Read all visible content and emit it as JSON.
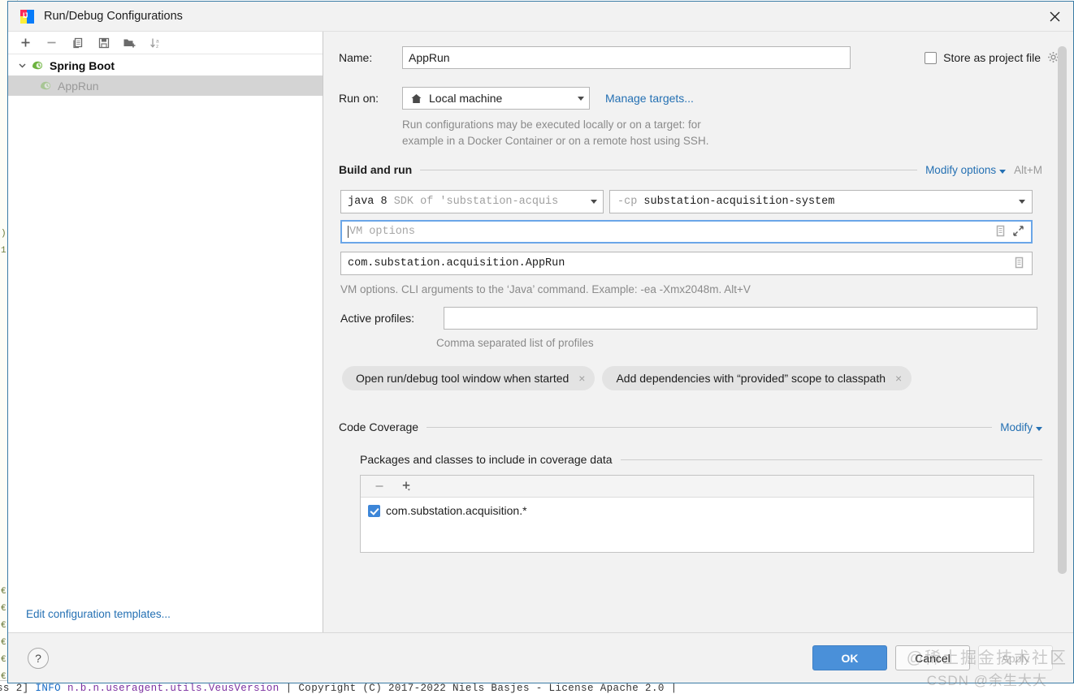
{
  "window": {
    "title": "Run/Debug Configurations",
    "app_icon": "intellij-idea-icon",
    "close_icon": "close-icon"
  },
  "tree_toolbar": {
    "items": [
      {
        "name": "add-configuration-button",
        "icon": "plus-icon"
      },
      {
        "name": "remove-configuration-button",
        "icon": "minus-icon"
      },
      {
        "name": "copy-configuration-button",
        "icon": "copy-icon"
      },
      {
        "name": "save-configuration-button",
        "icon": "save-icon"
      },
      {
        "name": "new-folder-button",
        "icon": "folder-add-icon"
      },
      {
        "name": "sort-configurations-button",
        "icon": "sort-alpha-icon"
      }
    ]
  },
  "tree": {
    "group_label": "Spring Boot",
    "child_label": "AppRun",
    "edit_templates_link": "Edit configuration templates..."
  },
  "form": {
    "name_label": "Name:",
    "name_value": "AppRun",
    "store_as_project_file_label": "Store as project file",
    "store_as_project_file_checked": false,
    "run_on_label": "Run on:",
    "run_on_value": "Local machine",
    "manage_targets_link": "Manage targets...",
    "run_on_hint_line1": "Run configurations may be executed locally or on a target: for",
    "run_on_hint_line2": "example in a Docker Container or on a remote host using SSH."
  },
  "build_and_run": {
    "section_title": "Build and run",
    "modify_options_link": "Modify options",
    "modify_options_shortcut": "Alt+M",
    "sdk_value_bold": "java 8",
    "sdk_value_dim": " SDK of 'substation-acquis",
    "classpath_prefix": "-cp ",
    "classpath_value": "substation-acquisition-system",
    "vm_options_placeholder": "VM options",
    "main_class_value": "com.substation.acquisition.AppRun",
    "vm_options_hint": "VM options. CLI arguments to the ‘Java’ command. Example: -ea -Xmx2048m. Alt+V",
    "active_profiles_label": "Active profiles:",
    "active_profiles_value": "",
    "active_profiles_hint": "Comma separated list of profiles",
    "chips": [
      {
        "label": "Open run/debug tool window when started",
        "close": "×"
      },
      {
        "label": "Add dependencies with “provided” scope to classpath",
        "close": "×"
      }
    ]
  },
  "code_coverage": {
    "section_title": "Code Coverage",
    "modify_link": "Modify",
    "packages_title": "Packages and classes to include in coverage data",
    "toolbar": [
      {
        "name": "coverage-remove-button",
        "icon": "minus-icon"
      },
      {
        "name": "coverage-add-button",
        "icon": "plus-dropdown-icon"
      }
    ],
    "items": [
      {
        "label": "com.substation.acquisition.*",
        "checked": true
      }
    ]
  },
  "footer": {
    "help_label": "?",
    "ok_label": "OK",
    "cancel_label": "Cancel",
    "apply_label": "Apply"
  },
  "watermark": {
    "line1": "@稀土掘金技术社区",
    "line2": "CSDN @余生大大"
  },
  "background": {
    "gutter_lines": [
      "",
      "",
      ").",
      "1",
      "",
      "",
      "",
      "",
      "",
      "",
      "",
      "",
      "",
      "",
      "",
      "",
      "",
      "",
      "",
      "",
      "",
      "",
      "",
      "€",
      "€",
      "€",
      "€",
      "€",
      "€"
    ],
    "console_line": "ss 2] INFO  n.b.n.useragent.utils.VeusVersion      | Copyright (C) 2017-2022 Niels Basjes - License Apache 2.0 |"
  },
  "colors": {
    "accent_blue": "#2470b3",
    "ok_button": "#4a90d9",
    "dialog_border": "#3a7ba5",
    "selection_gray": "#d4d4d4",
    "focus_border": "#6aa6e8",
    "checkbox_blue": "#3d86d8",
    "spring_green": "#6db33f"
  }
}
